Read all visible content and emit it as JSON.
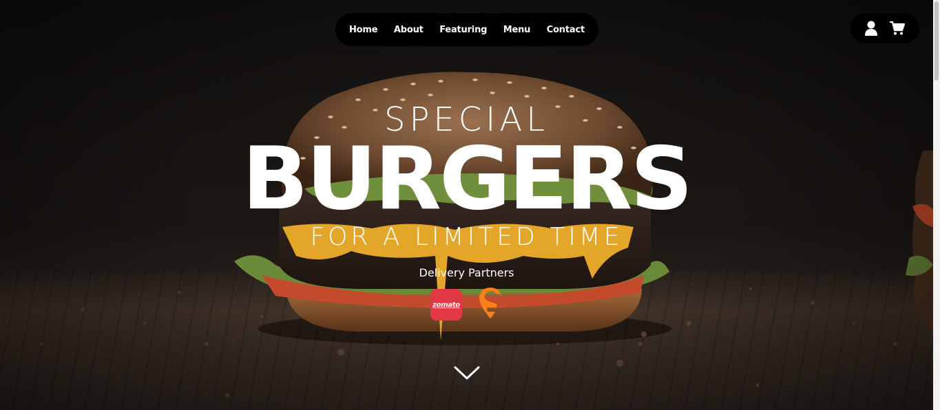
{
  "nav": {
    "items": [
      {
        "label": "Home"
      },
      {
        "label": "About"
      },
      {
        "label": "Featuring"
      },
      {
        "label": "Menu"
      },
      {
        "label": "Contact"
      }
    ]
  },
  "actions": {
    "user_icon": "user-icon",
    "cart_icon": "cart-icon"
  },
  "hero": {
    "eyebrow": "SPECIAL",
    "title": "BURGERS",
    "subtitle": "FOR A LIMITED TIME",
    "partners_label": "Delivery Partners",
    "partners": [
      {
        "name": "zomato",
        "color": "#e23744"
      },
      {
        "name": "swiggy-icon",
        "color": "#fc8019"
      }
    ],
    "scroll_icon": "chevron-down-icon"
  },
  "colors": {
    "nav_bg": "#000000",
    "text": "#ffffff"
  }
}
